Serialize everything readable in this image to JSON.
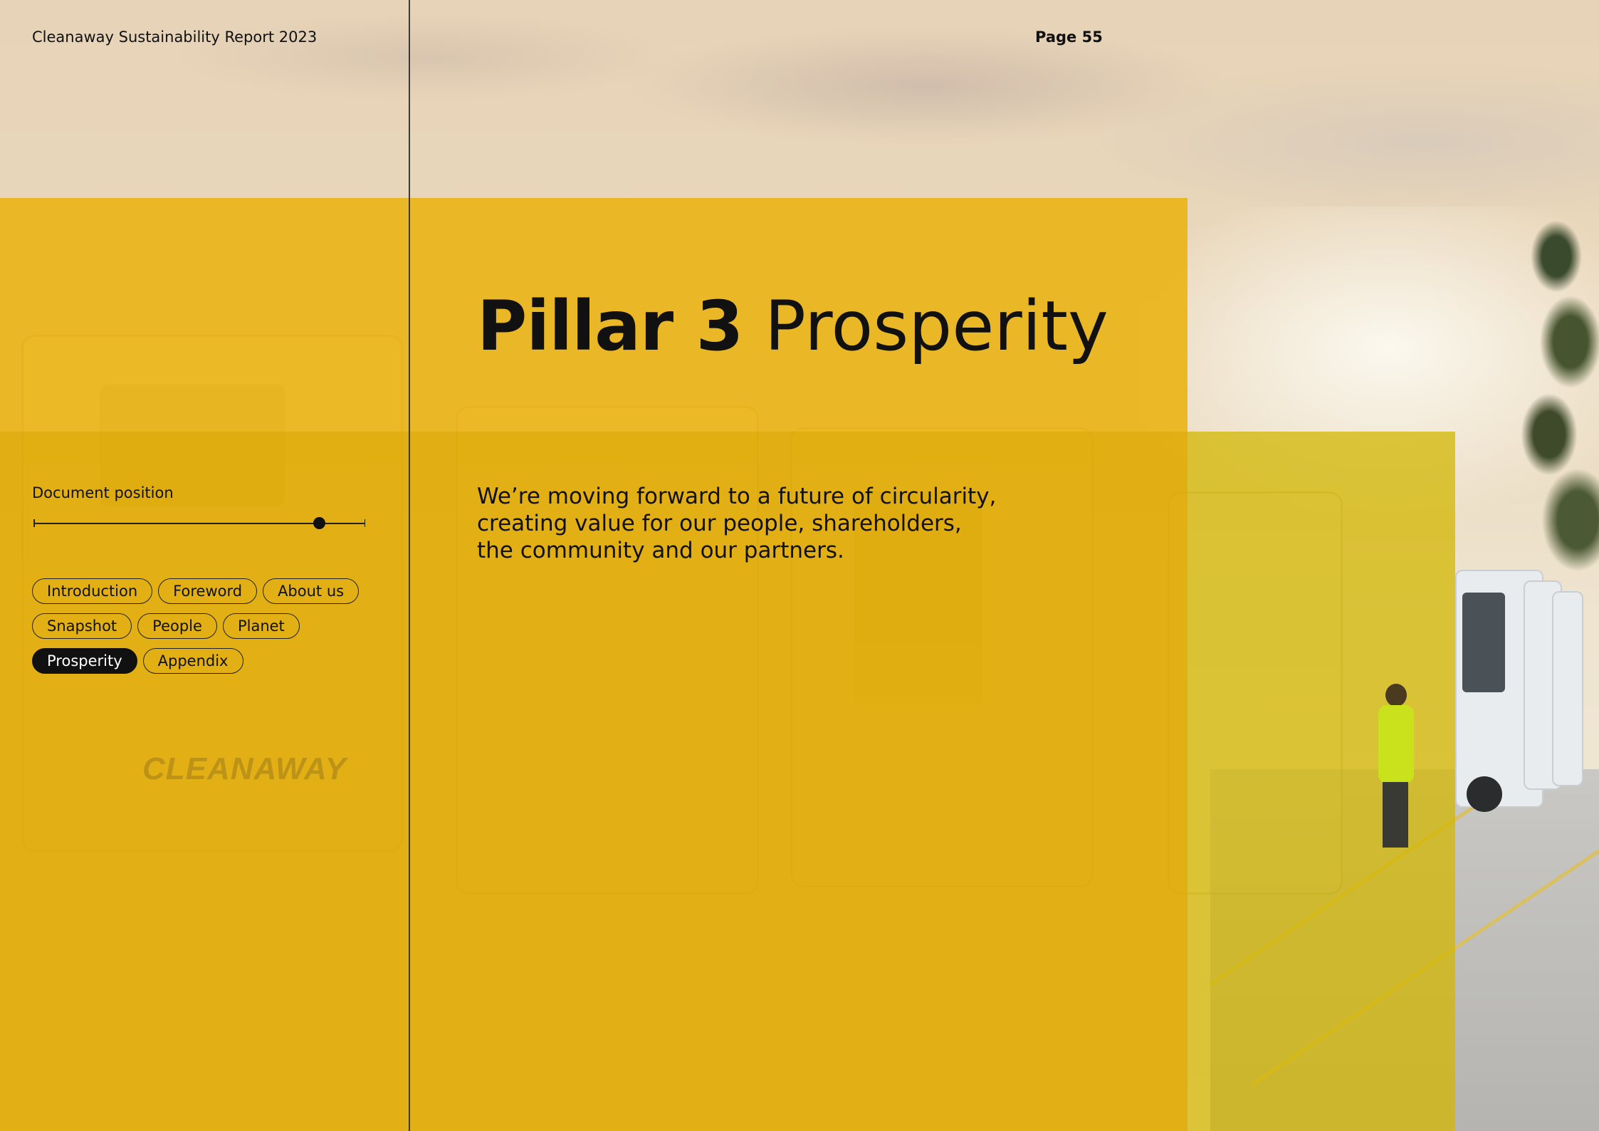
{
  "header": {
    "title": "Cleanaway Sustainability Report 2023",
    "page": "Page 55"
  },
  "heading": {
    "bold": "Pillar 3",
    "light": "Prosperity"
  },
  "intro": {
    "line1": "We’re moving forward to a future of circularity,",
    "line2": "creating value for our people, shareholders,",
    "line3": "the community and our partners."
  },
  "sidebar": {
    "position_label": "Document position",
    "position_value": 0.86,
    "nav": [
      {
        "label": "Introduction",
        "active": false
      },
      {
        "label": "Foreword",
        "active": false
      },
      {
        "label": "About us",
        "active": false
      },
      {
        "label": "Snapshot",
        "active": false
      },
      {
        "label": "People",
        "active": false
      },
      {
        "label": "Planet",
        "active": false
      },
      {
        "label": "Prosperity",
        "active": true
      },
      {
        "label": "Appendix",
        "active": false
      }
    ]
  },
  "photo": {
    "truck_logo_text": "CLEANAWAY"
  },
  "colors": {
    "accent_yellow": "#E0AA00",
    "ink": "#111111"
  }
}
